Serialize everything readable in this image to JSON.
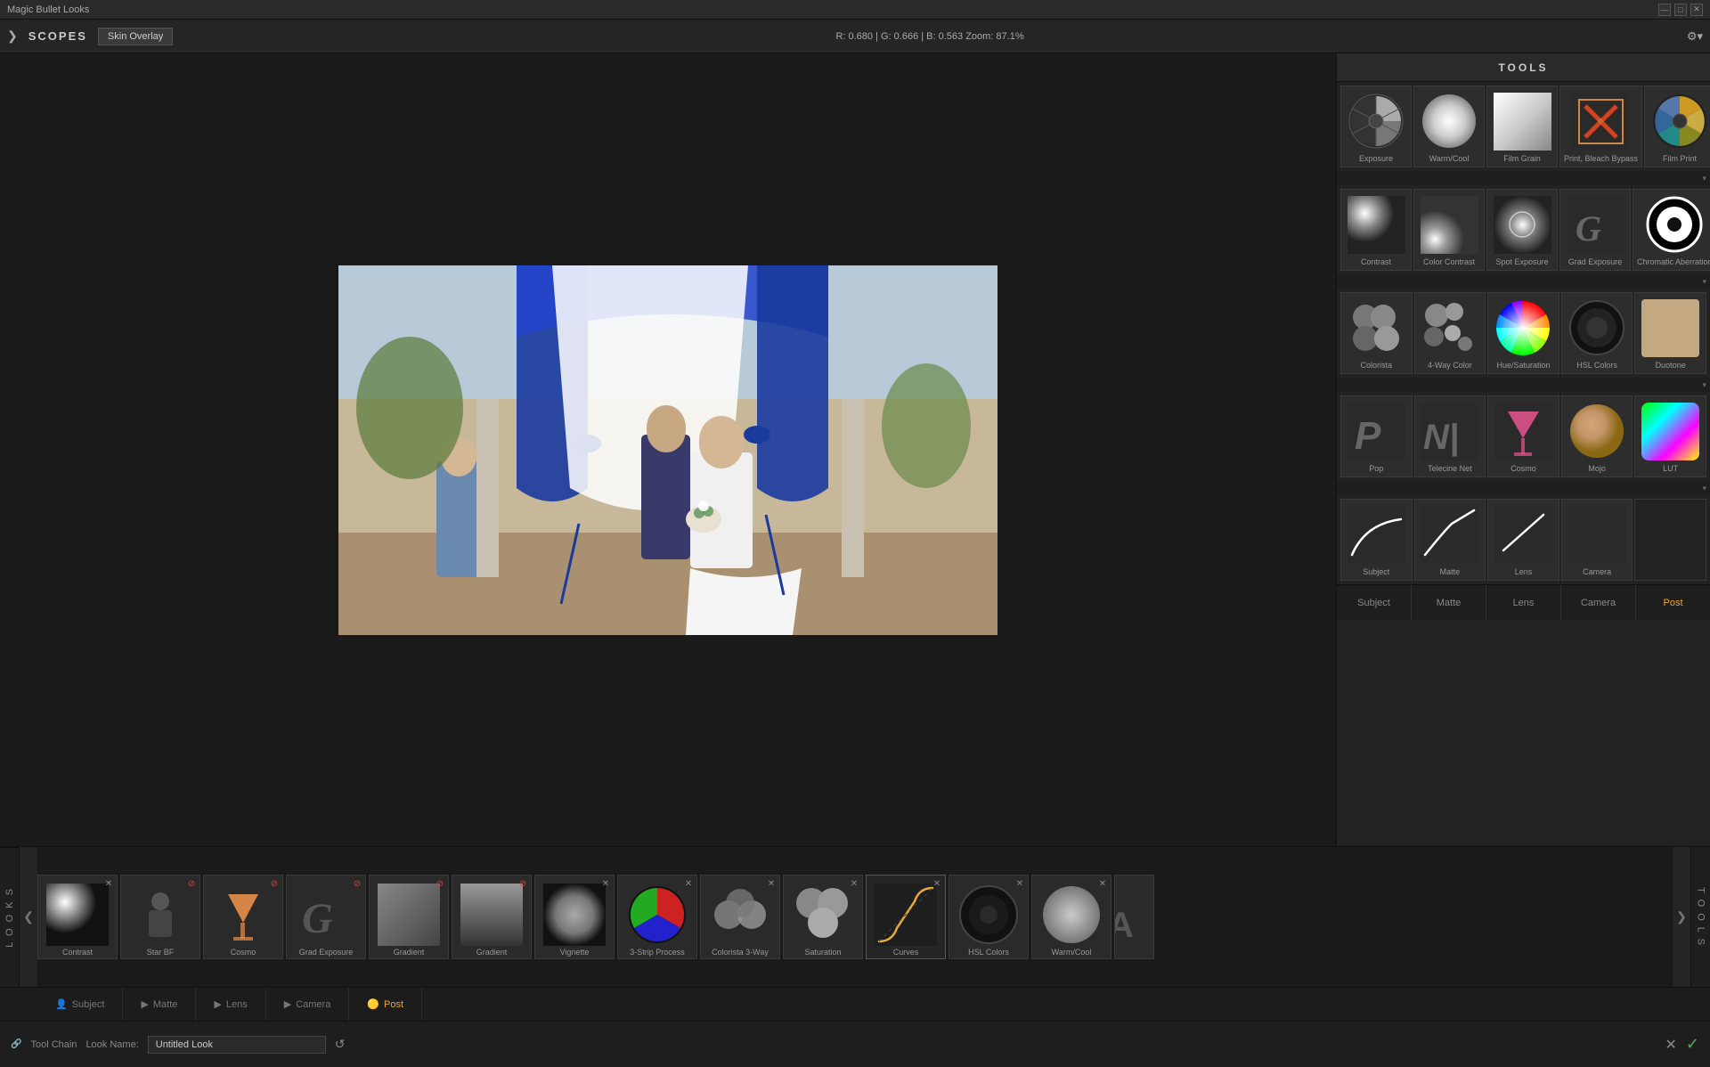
{
  "titleBar": {
    "title": "Magic Bullet Looks",
    "buttons": [
      "—",
      "□",
      "✕"
    ]
  },
  "topToolbar": {
    "arrow": "❯",
    "scopes": "SCOPES",
    "skinOverlay": "Skin Overlay",
    "rgbInfo": "R: 0.680 | G: 0.666 | B: 0.563   Zoom: 87.1%",
    "gearIcon": "⚙"
  },
  "toolsPanel": {
    "header": "TOOLS",
    "tools": [
      {
        "id": "exposure",
        "label": "Exposure",
        "type": "exposure"
      },
      {
        "id": "warm-cool",
        "label": "Warm/Cool",
        "type": "warm-cool"
      },
      {
        "id": "film-grain",
        "label": "Film Grain",
        "type": "film-grain"
      },
      {
        "id": "print-bleach",
        "label": "Print, Bleach Bypass",
        "type": "print-bleach"
      },
      {
        "id": "film-print",
        "label": "Film Print",
        "type": "film-print"
      },
      {
        "id": "contrast",
        "label": "Contrast",
        "type": "contrast"
      },
      {
        "id": "color-contrast",
        "label": "Color Contrast",
        "type": "color-contrast"
      },
      {
        "id": "spot-exposure",
        "label": "Spot Exposure",
        "type": "spot-exposure"
      },
      {
        "id": "grad-exposure",
        "label": "Grad Exposure",
        "type": "grad-exposure"
      },
      {
        "id": "chromatic-aberration",
        "label": "Chromatic Aberration",
        "type": "chromatic"
      },
      {
        "id": "colorista",
        "label": "Colorista",
        "type": "colorista"
      },
      {
        "id": "4way-color",
        "label": "4-Way Color",
        "type": "4way"
      },
      {
        "id": "hue-saturation",
        "label": "Hue/Saturation",
        "type": "hue-sat"
      },
      {
        "id": "hsl-colors",
        "label": "HSL Colors",
        "type": "hsl-colors"
      },
      {
        "id": "duotone",
        "label": "Duotone",
        "type": "duotone"
      },
      {
        "id": "pop",
        "label": "Pop",
        "type": "pop"
      },
      {
        "id": "telecine-net",
        "label": "Telecine Net",
        "type": "telecine"
      },
      {
        "id": "cosmo",
        "label": "Cosmo",
        "type": "cosmo"
      },
      {
        "id": "mojo",
        "label": "Mojo",
        "type": "mojo"
      },
      {
        "id": "lut",
        "label": "LUT",
        "type": "lut"
      },
      {
        "id": "subject-line",
        "label": "Subject",
        "type": "line"
      },
      {
        "id": "matte-line",
        "label": "Matte",
        "type": "line2"
      },
      {
        "id": "lens-line",
        "label": "Lens",
        "type": "lens-line"
      },
      {
        "id": "camera-line",
        "label": "Camera",
        "type": "camera-line"
      },
      {
        "id": "post-empty",
        "label": "",
        "type": "empty"
      }
    ],
    "tabs": [
      {
        "id": "subject",
        "label": "Subject",
        "active": false
      },
      {
        "id": "matte",
        "label": "Matte",
        "active": false
      },
      {
        "id": "lens",
        "label": "Lens",
        "active": false
      },
      {
        "id": "camera",
        "label": "Camera",
        "active": false
      },
      {
        "id": "post",
        "label": "Post",
        "active": true
      }
    ]
  },
  "filmstrip": {
    "looksLabel": "L\nO\nO\nK\nS",
    "toolsLabel": "T\nO\nO\nL\nS",
    "leftArrow": "❮",
    "rightArrow": "❯",
    "items": [
      {
        "id": "contrast",
        "label": "Contrast",
        "type": "contrast-strip"
      },
      {
        "id": "star-bf",
        "label": "Star BF",
        "type": "star-bf"
      },
      {
        "id": "cosmo",
        "label": "Cosmo",
        "type": "cosmo-strip"
      },
      {
        "id": "grad-exposure",
        "label": "Grad Exposure",
        "type": "grad-strip"
      },
      {
        "id": "gradient",
        "label": "Gradient",
        "type": "gradient-strip"
      },
      {
        "id": "gradient2",
        "label": "Gradient",
        "type": "gradient-strip2"
      },
      {
        "id": "vignette",
        "label": "Vignette",
        "type": "vignette-strip"
      },
      {
        "id": "3strip",
        "label": "3-Strip Process",
        "type": "three-strip"
      },
      {
        "id": "colorista3way",
        "label": "Colorista 3-Way",
        "type": "colorista-3way"
      },
      {
        "id": "saturation",
        "label": "Saturation",
        "type": "saturation-strip"
      },
      {
        "id": "curves",
        "label": "Curves",
        "type": "curves-strip"
      },
      {
        "id": "hsl-colors",
        "label": "HSL Colors",
        "type": "hsl-strip"
      },
      {
        "id": "warm-cool",
        "label": "Warm/Cool",
        "type": "warm-strip"
      }
    ]
  },
  "sectionTabs": [
    {
      "id": "subject",
      "label": "Subject",
      "icon": "👤",
      "active": false
    },
    {
      "id": "matte",
      "label": "Matte",
      "icon": "▶",
      "active": false
    },
    {
      "id": "lens",
      "label": "Lens",
      "icon": "▶",
      "active": false
    },
    {
      "id": "camera",
      "label": "Camera",
      "icon": "▶",
      "active": false
    },
    {
      "id": "post",
      "label": "Post",
      "icon": "🟡",
      "active": true
    }
  ],
  "bottomToolbar": {
    "toolChain": "Tool Chain",
    "lookName": "Look Name:",
    "lookNameValue": "Untitled Look",
    "resetIcon": "↺",
    "xLabel": "✕",
    "checkLabel": "✓"
  }
}
